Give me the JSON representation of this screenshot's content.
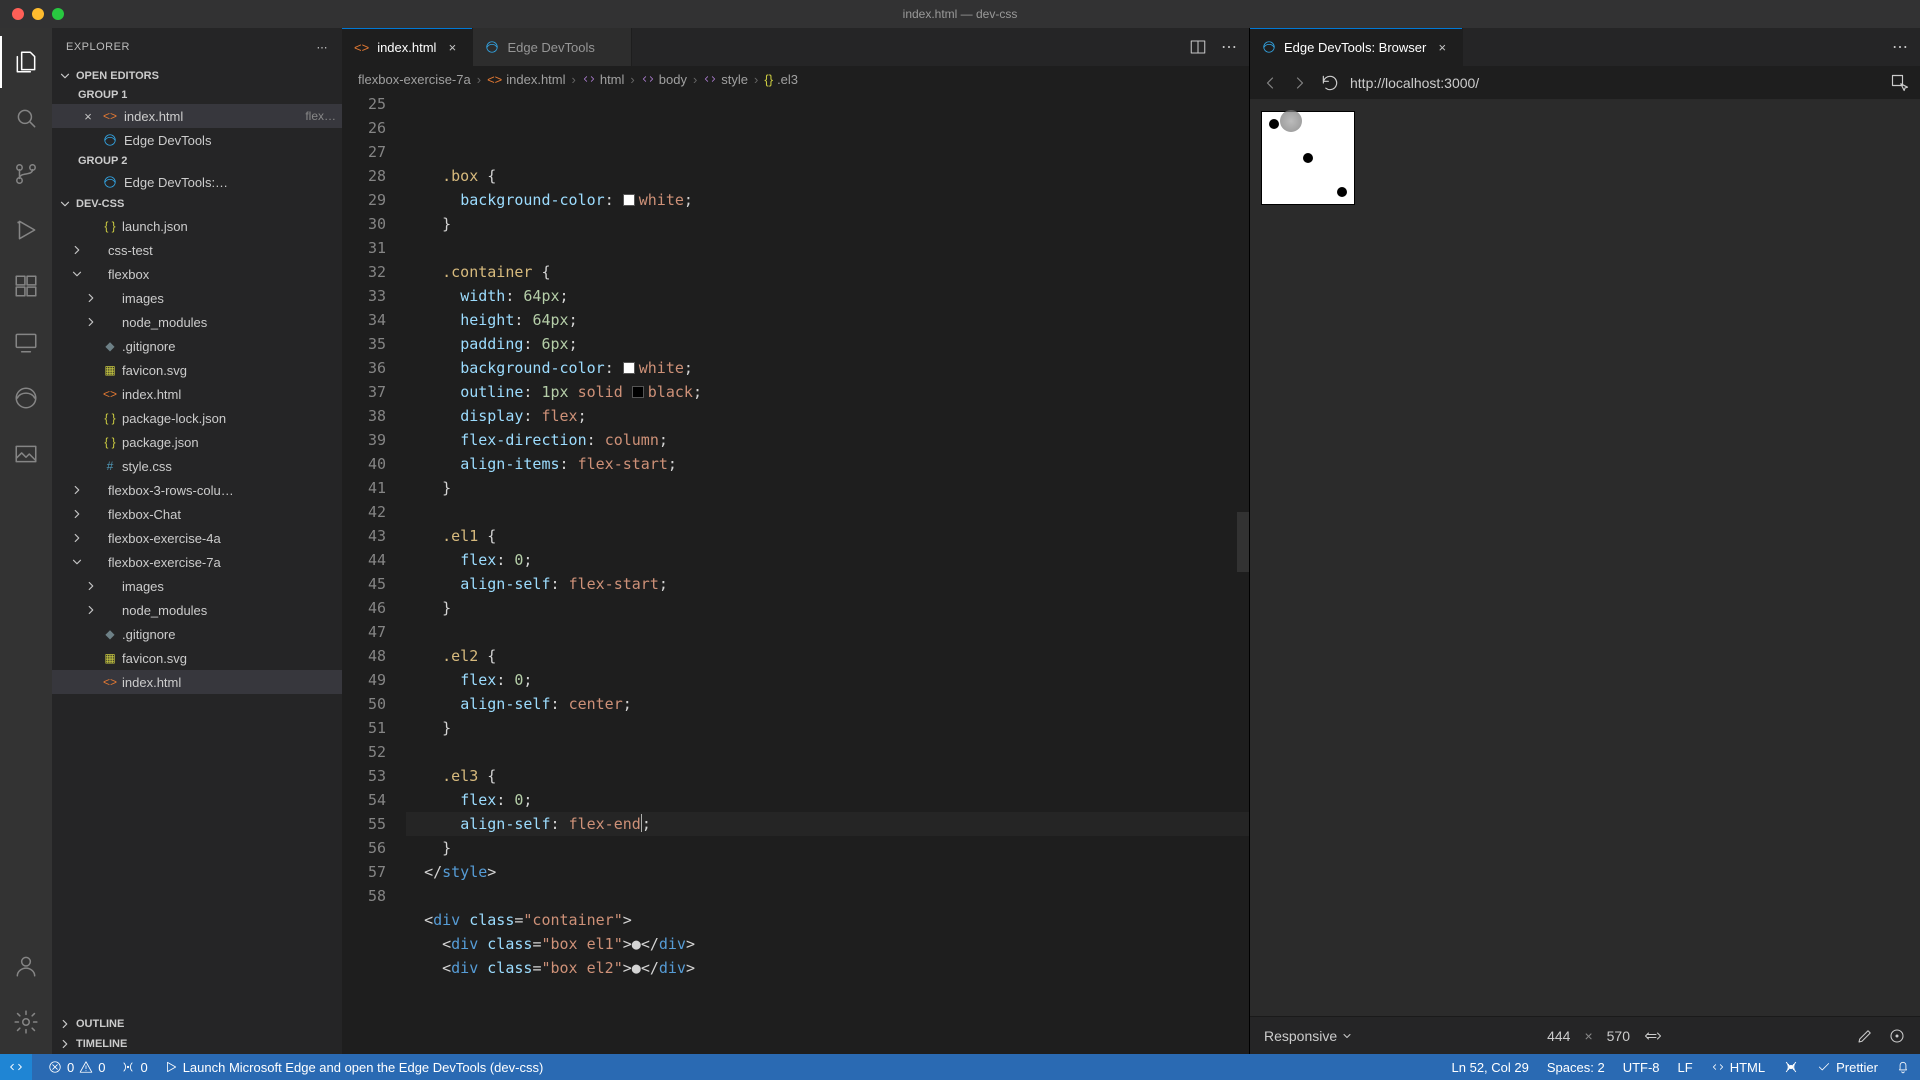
{
  "title": "index.html — dev-css",
  "activity": {
    "items": [
      "explorer",
      "search",
      "scm",
      "debug",
      "extensions",
      "remote",
      "edge",
      "screenshot"
    ],
    "bottom": [
      "account",
      "settings"
    ]
  },
  "sidebar": {
    "title": "EXPLORER",
    "sections": {
      "openEditors": {
        "label": "OPEN EDITORS",
        "group1": "GROUP 1",
        "group2": "GROUP 2",
        "items": [
          {
            "label": "index.html",
            "desc": "flex…",
            "icon": "html",
            "active": true,
            "close": true
          },
          {
            "label": "Edge DevTools",
            "icon": "edge"
          }
        ],
        "items2": [
          {
            "label": "Edge DevTools:…",
            "icon": "edge"
          }
        ]
      },
      "project": {
        "label": "DEV-CSS",
        "tree": [
          {
            "depth": 1,
            "chev": false,
            "icon": "json",
            "label": "launch.json"
          },
          {
            "depth": 0,
            "chev": "right",
            "icon": "folder",
            "label": "css-test"
          },
          {
            "depth": 0,
            "chev": "down",
            "icon": "folder",
            "label": "flexbox"
          },
          {
            "depth": 1,
            "chev": "right",
            "icon": "folder",
            "label": "images"
          },
          {
            "depth": 1,
            "chev": "right",
            "icon": "folder",
            "label": "node_modules"
          },
          {
            "depth": 1,
            "chev": false,
            "icon": "git",
            "label": ".gitignore"
          },
          {
            "depth": 1,
            "chev": false,
            "icon": "svg",
            "label": "favicon.svg"
          },
          {
            "depth": 1,
            "chev": false,
            "icon": "html",
            "label": "index.html"
          },
          {
            "depth": 1,
            "chev": false,
            "icon": "json",
            "label": "package-lock.json"
          },
          {
            "depth": 1,
            "chev": false,
            "icon": "json",
            "label": "package.json"
          },
          {
            "depth": 1,
            "chev": false,
            "icon": "css",
            "label": "style.css"
          },
          {
            "depth": 0,
            "chev": "right",
            "icon": "folder",
            "label": "flexbox-3-rows-colu…"
          },
          {
            "depth": 0,
            "chev": "right",
            "icon": "folder",
            "label": "flexbox-Chat"
          },
          {
            "depth": 0,
            "chev": "right",
            "icon": "folder",
            "label": "flexbox-exercise-4a"
          },
          {
            "depth": 0,
            "chev": "down",
            "icon": "folder",
            "label": "flexbox-exercise-7a"
          },
          {
            "depth": 1,
            "chev": "right",
            "icon": "folder",
            "label": "images"
          },
          {
            "depth": 1,
            "chev": "right",
            "icon": "folder",
            "label": "node_modules"
          },
          {
            "depth": 1,
            "chev": false,
            "icon": "git",
            "label": ".gitignore"
          },
          {
            "depth": 1,
            "chev": false,
            "icon": "svg",
            "label": "favicon.svg"
          },
          {
            "depth": 1,
            "chev": false,
            "icon": "html",
            "label": "index.html",
            "sel": true
          }
        ]
      },
      "outline": "OUTLINE",
      "timeline": "TIMELINE"
    }
  },
  "tabs": {
    "left": [
      {
        "label": "index.html",
        "icon": "html",
        "active": true,
        "close": true
      },
      {
        "label": "Edge DevTools",
        "icon": "edge"
      }
    ],
    "right": [
      {
        "label": "Edge DevTools: Browser",
        "icon": "edge",
        "active": true,
        "close": true
      }
    ]
  },
  "breadcrumbs": {
    "items": [
      {
        "label": "flexbox-exercise-7a",
        "icon": ""
      },
      {
        "label": "index.html",
        "icon": "html"
      },
      {
        "label": "html",
        "icon": "sym"
      },
      {
        "label": "body",
        "icon": "sym"
      },
      {
        "label": "style",
        "icon": "sym"
      },
      {
        "label": ".el3",
        "icon": "brace"
      }
    ]
  },
  "editor": {
    "startLine": 25,
    "lines": [
      {
        "n": 25,
        "html": "    <span class='tok-sel'>.box</span> <span class='tok-punc'>{</span>"
      },
      {
        "n": 26,
        "html": "      <span class='tok-prop'>background-color</span><span class='tok-punc'>:</span> <span class='swatch-w'></span><span class='tok-val'>white</span><span class='tok-punc'>;</span>"
      },
      {
        "n": 27,
        "html": "    <span class='tok-punc'>}</span>"
      },
      {
        "n": 28,
        "html": ""
      },
      {
        "n": 29,
        "html": "    <span class='tok-sel'>.container</span> <span class='tok-punc'>{</span>"
      },
      {
        "n": 30,
        "html": "      <span class='tok-prop'>width</span><span class='tok-punc'>:</span> <span class='tok-num'>64px</span><span class='tok-punc'>;</span>"
      },
      {
        "n": 31,
        "html": "      <span class='tok-prop'>height</span><span class='tok-punc'>:</span> <span class='tok-num'>64px</span><span class='tok-punc'>;</span>"
      },
      {
        "n": 32,
        "html": "      <span class='tok-prop'>padding</span><span class='tok-punc'>:</span> <span class='tok-num'>6px</span><span class='tok-punc'>;</span>"
      },
      {
        "n": 33,
        "html": "      <span class='tok-prop'>background-color</span><span class='tok-punc'>:</span> <span class='swatch-w'></span><span class='tok-val'>white</span><span class='tok-punc'>;</span>"
      },
      {
        "n": 34,
        "html": "      <span class='tok-prop'>outline</span><span class='tok-punc'>:</span> <span class='tok-num'>1px</span> <span class='tok-val'>solid</span> <span class='swatch-b'></span><span class='tok-val'>black</span><span class='tok-punc'>;</span>"
      },
      {
        "n": 35,
        "html": "      <span class='tok-prop'>display</span><span class='tok-punc'>:</span> <span class='tok-val'>flex</span><span class='tok-punc'>;</span>"
      },
      {
        "n": 36,
        "html": "      <span class='tok-prop'>flex-direction</span><span class='tok-punc'>:</span> <span class='tok-val'>column</span><span class='tok-punc'>;</span>"
      },
      {
        "n": 37,
        "html": "      <span class='tok-prop'>align-items</span><span class='tok-punc'>:</span> <span class='tok-val'>flex-start</span><span class='tok-punc'>;</span>"
      },
      {
        "n": 38,
        "html": "    <span class='tok-punc'>}</span>"
      },
      {
        "n": 39,
        "html": ""
      },
      {
        "n": 40,
        "html": "    <span class='tok-sel'>.el1</span> <span class='tok-punc'>{</span>"
      },
      {
        "n": 41,
        "html": "      <span class='tok-prop'>flex</span><span class='tok-punc'>:</span> <span class='tok-num'>0</span><span class='tok-punc'>;</span>"
      },
      {
        "n": 42,
        "html": "      <span class='tok-prop'>align-self</span><span class='tok-punc'>:</span> <span class='tok-val'>flex-start</span><span class='tok-punc'>;</span>"
      },
      {
        "n": 43,
        "html": "    <span class='tok-punc'>}</span>"
      },
      {
        "n": 44,
        "html": ""
      },
      {
        "n": 45,
        "html": "    <span class='tok-sel'>.el2</span> <span class='tok-punc'>{</span>"
      },
      {
        "n": 46,
        "html": "      <span class='tok-prop'>flex</span><span class='tok-punc'>:</span> <span class='tok-num'>0</span><span class='tok-punc'>;</span>"
      },
      {
        "n": 47,
        "html": "      <span class='tok-prop'>align-self</span><span class='tok-punc'>:</span> <span class='tok-val'>center</span><span class='tok-punc'>;</span>"
      },
      {
        "n": 48,
        "html": "    <span class='tok-punc'>}</span>"
      },
      {
        "n": 49,
        "html": ""
      },
      {
        "n": 50,
        "html": "    <span class='tok-sel'>.el3</span> <span class='tok-punc'>{</span>"
      },
      {
        "n": 51,
        "html": "      <span class='tok-prop'>flex</span><span class='tok-punc'>:</span> <span class='tok-num'>0</span><span class='tok-punc'>;</span>"
      },
      {
        "n": 52,
        "html": "      <span class='tok-prop'>align-self</span><span class='tok-punc'>:</span> <span class='tok-val'>flex-end</span><span class='code-caret'></span><span class='tok-punc'>;</span>",
        "cursor": true
      },
      {
        "n": 53,
        "html": "    <span class='tok-punc'>}</span>"
      },
      {
        "n": 54,
        "html": "  <span class='tok-punc'>&lt;/</span><span class='tok-tag'>style</span><span class='tok-punc'>&gt;</span>"
      },
      {
        "n": 55,
        "html": ""
      },
      {
        "n": 56,
        "html": "  <span class='tok-punc'>&lt;</span><span class='tok-tag'>div</span> <span class='tok-attr'>class</span><span class='tok-punc'>=</span><span class='tok-str'>\"container\"</span><span class='tok-punc'>&gt;</span>"
      },
      {
        "n": 57,
        "html": "    <span class='tok-punc'>&lt;</span><span class='tok-tag'>div</span> <span class='tok-attr'>class</span><span class='tok-punc'>=</span><span class='tok-str'>\"box el1\"</span><span class='tok-punc'>&gt;</span>●<span class='tok-punc'>&lt;/</span><span class='tok-tag'>div</span><span class='tok-punc'>&gt;</span>"
      },
      {
        "n": 58,
        "html": "    <span class='tok-punc'>&lt;</span><span class='tok-tag'>div</span> <span class='tok-attr'>class</span><span class='tok-punc'>=</span><span class='tok-str'>\"box el2\"</span><span class='tok-punc'>&gt;</span>●<span class='tok-punc'>&lt;/</span><span class='tok-tag'>div</span><span class='tok-punc'>&gt;</span>"
      }
    ]
  },
  "browser": {
    "url": "http://localhost:3000/",
    "responsive": "Responsive",
    "width": "444",
    "height": "570"
  },
  "status": {
    "errors": "0",
    "warnings": "0",
    "ports": "0",
    "launch": "Launch Microsoft Edge and open the Edge DevTools (dev-css)",
    "cursor": "Ln 52, Col 29",
    "spaces": "Spaces: 2",
    "encoding": "UTF-8",
    "eol": "LF",
    "lang": "HTML",
    "prettier": "Prettier"
  }
}
